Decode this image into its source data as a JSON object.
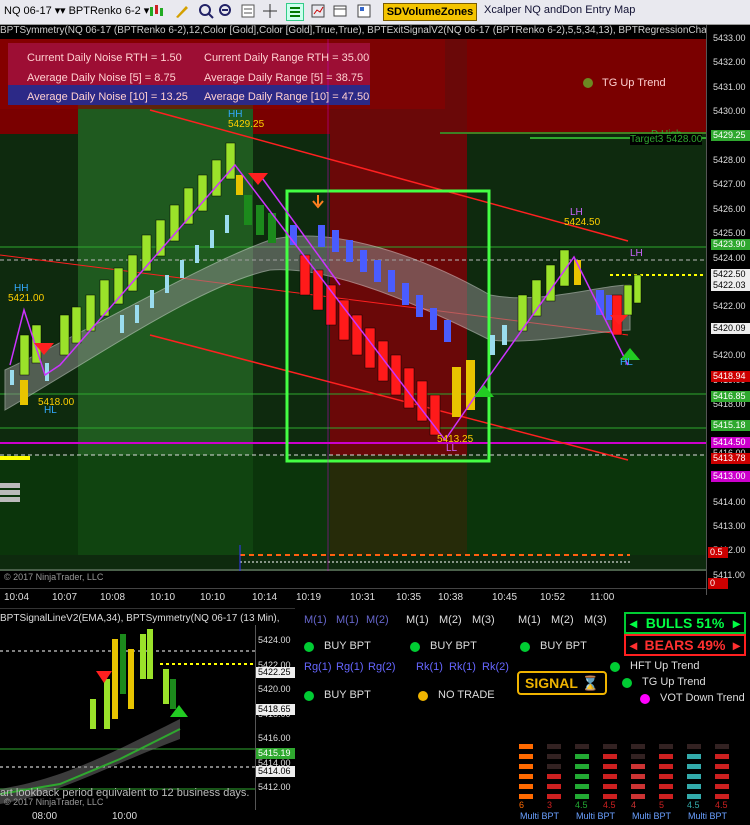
{
  "toolbar": {
    "instrument": "NQ 06-17",
    "bar_type": "BPTRenko 6-2",
    "sd_button": "SDVolumeZones",
    "xcalper": "Xcalper NQ and",
    "don_entry": "Don Entry Map"
  },
  "main_chart": {
    "indicators_title": "BPTSymmetry(NQ 06-17 (BPTRenko 6-2),12,Color [Gold],Color [Gold],True,True), BPTExitSignalV2(NQ 06-17 (BPTRenko 6-2),5,5,34,13), BPTRegressionChannel(NQ 06-17",
    "noise_box": {
      "current_noise": "Current Daily Noise RTH = 1.50",
      "current_range": "Current Daily Range RTH = 35.00",
      "avg_noise_5": "Average Daily Noise [5] = 8.75",
      "avg_range_5": "Average Daily Range [5] = 38.75",
      "avg_noise_10": "Average Daily Noise [10] = 13.25",
      "avg_range_10": "Average Daily Range [10] = 47.50"
    },
    "trend_label": "TG Up Trend",
    "annotations": {
      "hh1": "HH",
      "hh1_price": "5421.00",
      "hh2": "HH",
      "hh2_price": "5429.25",
      "hl1_price": "5418.00",
      "hl1": "HL",
      "ll_price": "5413.25",
      "ll": "LL",
      "lh_price": "5424.50",
      "lh": "LH",
      "lh2": "LH",
      "hl2": "HL",
      "dhigh": "D High",
      "target": "Target3 5428.00"
    },
    "price_axis": {
      "ticks": [
        "5433.00",
        "5432.00",
        "5431.00",
        "5430.00",
        "5429.00",
        "5428.00",
        "5427.00",
        "5426.00",
        "5425.00",
        "5424.00",
        "5423.00",
        "5422.00",
        "5421.00",
        "5420.00",
        "5419.00",
        "5418.00",
        "5417.00",
        "5416.00",
        "5415.00",
        "5414.00",
        "5413.00",
        "5412.00",
        "5411.00"
      ],
      "labels": [
        {
          "text": "5429.25",
          "color": "#2fa82f"
        },
        {
          "text": "5423.90",
          "color": "#2fa82f"
        },
        {
          "text": "5422.50",
          "color": "#000000"
        },
        {
          "text": "5422.03",
          "color": "#000000"
        },
        {
          "text": "5420.09",
          "color": "#000000"
        },
        {
          "text": "5418.94",
          "color": "#cc0000"
        },
        {
          "text": "5416.85",
          "color": "#2fa82f"
        },
        {
          "text": "5415.18",
          "color": "#2fa82f"
        },
        {
          "text": "5414.50",
          "color": "#cc00cc"
        },
        {
          "text": "5413.78",
          "color": "#cc0000"
        },
        {
          "text": "5413.00",
          "color": "#cc00cc"
        }
      ]
    },
    "time_axis": [
      "10:04",
      "10:07",
      "10:08",
      "10:10",
      "10:10",
      "10:14",
      "10:19",
      "10:31",
      "10:35",
      "10:38",
      "10:45",
      "10:52",
      "11:00"
    ],
    "copyright": "© 2017 NinjaTrader, LLC",
    "sub_panel_vals": [
      "0.5",
      "0"
    ]
  },
  "sub_chart": {
    "title": "BPTSignalLineV2(EMA,34), BPTSymmetry(NQ 06-17 (13 Min),",
    "ticks": [
      "5424.00",
      "5422.00",
      "5420.00",
      "5418.00",
      "5416.00",
      "5414.00",
      "5412.00"
    ],
    "labels": [
      {
        "text": "5422.25",
        "color": "#000000"
      },
      {
        "text": "5418.65",
        "color": "#000000"
      },
      {
        "text": "5415.19",
        "color": "#2fa82f"
      },
      {
        "text": "5414.06",
        "color": "#000000"
      }
    ],
    "lookback_note": "art lookback period equivalent to 12 business days.",
    "copyright": "© 2017 NinjaTrader, LLC",
    "times": [
      "08:00",
      "10:00"
    ]
  },
  "dashboard": {
    "m_row_a": [
      "M(1)",
      "M(1)",
      "M(2)"
    ],
    "m_row_b": [
      "M(1)",
      "M(2)",
      "M(3)"
    ],
    "m_row_c": [
      "M(1)",
      "M(2)",
      "M(3)"
    ],
    "buy1": "BUY BPT",
    "buy2": "BUY BPT",
    "buy3": "BUY BPT",
    "buy4": "BUY BPT",
    "rg": [
      "Rg(1)",
      "Rg(1)",
      "Rg(2)"
    ],
    "rk": [
      "Rk(1)",
      "Rk(1)",
      "Rk(2)"
    ],
    "no_trade": "NO TRADE",
    "bulls": "BULLS 51%",
    "bears": "BEARS 49%",
    "signal": "SIGNAL",
    "hft": "HFT Up Trend",
    "tg": "TG Up Trend",
    "vot": "VOT Down Trend",
    "meter_vals": [
      "6",
      "3",
      "4.5",
      "4.5",
      "4",
      "5",
      "4.5",
      "4.5"
    ],
    "meter_label": "Multi BPT",
    "colors": {
      "green": "#00cc33",
      "red": "#ff2020",
      "gold": "#f0b400",
      "magenta": "#ff00ff",
      "blue": "#3355ff"
    }
  }
}
